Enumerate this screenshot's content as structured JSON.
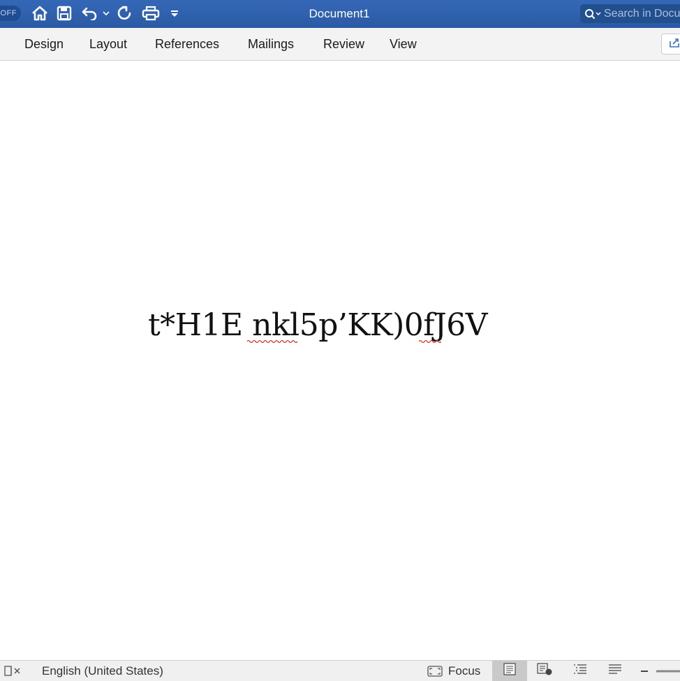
{
  "titlebar": {
    "autosave_label": "OFF",
    "document_title": "Document1",
    "search_placeholder": "Search in Document"
  },
  "ribbon": {
    "tabs": [
      {
        "label": "Design"
      },
      {
        "label": "Layout"
      },
      {
        "label": "References"
      },
      {
        "label": "Mailings"
      },
      {
        "label": "Review"
      },
      {
        "label": "View"
      }
    ]
  },
  "document": {
    "text_before": "t*H1E ",
    "misspelled_word_1": "nkl5p",
    "text_middle": "’KK)0",
    "misspelled_word_2": "fJ",
    "text_after": "6V",
    "spellcheck_color": "#d0342c"
  },
  "statusbar": {
    "language": "English (United States)",
    "focus_label": "Focus"
  },
  "icons": {
    "home": "home-icon",
    "save": "save-icon",
    "undo": "undo-icon",
    "redo": "redo-icon",
    "print": "print-icon",
    "customize": "customize-qat-icon",
    "search": "search-icon",
    "share": "share-icon",
    "proofing": "proofing-icon",
    "focus": "focus-icon"
  },
  "colors": {
    "titlebar_blue": "#2f62ae",
    "ribbon_bg": "#f3f3f3",
    "status_bg": "#f0f0f0"
  }
}
